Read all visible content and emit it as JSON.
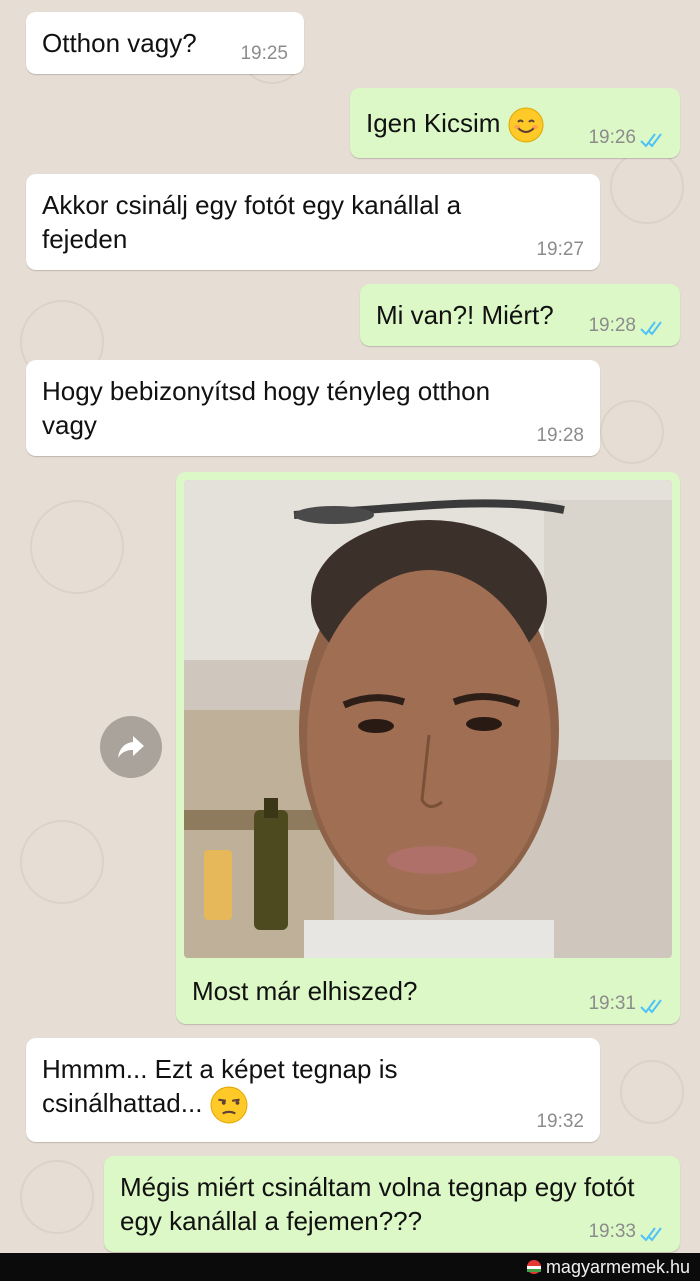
{
  "messages": [
    {
      "text": "Otthon vagy?",
      "time": "19:25"
    },
    {
      "text": "Igen Kicsim",
      "time": "19:26",
      "emoji": "smiling-face-emoji"
    },
    {
      "text": "Akkor csinálj egy fotót egy kanállal a fejeden",
      "time": "19:27"
    },
    {
      "text": "Mi van?! Miért?",
      "time": "19:28"
    },
    {
      "text": "Hogy bebizonyítsd hogy tényleg otthon vagy",
      "time": "19:28"
    },
    {
      "text": "Most már elhiszed?",
      "time": "19:31"
    },
    {
      "text": "Hmmm... Ezt a képet tegnap is csinálhattad...",
      "time": "19:32",
      "emoji": "unamused-face-emoji"
    },
    {
      "text": "Mégis miért csináltam volna tegnap egy fotót egy kanállal a fejemen???",
      "time": "19:33"
    }
  ],
  "colors": {
    "incoming_bubble": "#ffffff",
    "outgoing_bubble": "#dcf8c6",
    "read_ticks": "#4fc3f7",
    "wallpaper": "#e6ded4"
  },
  "footer": {
    "brand": "magyarmemek.hu"
  }
}
